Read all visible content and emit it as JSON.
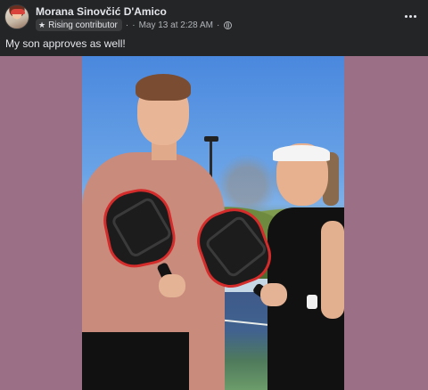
{
  "post": {
    "author": "Morana Sinovčić D'Amico",
    "badge_label": "Rising contributor",
    "date": "May 13 at 2:28 AM",
    "separator_dot": "·",
    "separator_dot2": "·",
    "text": "My son approves as well!"
  },
  "icons": {
    "badge": "star-icon",
    "audience": "globe-icon",
    "menu": "more-horizontal-icon"
  },
  "colors": {
    "background": "#242526",
    "media_backdrop": "#9b6f85",
    "text_primary": "#e4e6eb",
    "text_secondary": "#b0b3b8",
    "badge_bg": "#3a3b3c"
  }
}
